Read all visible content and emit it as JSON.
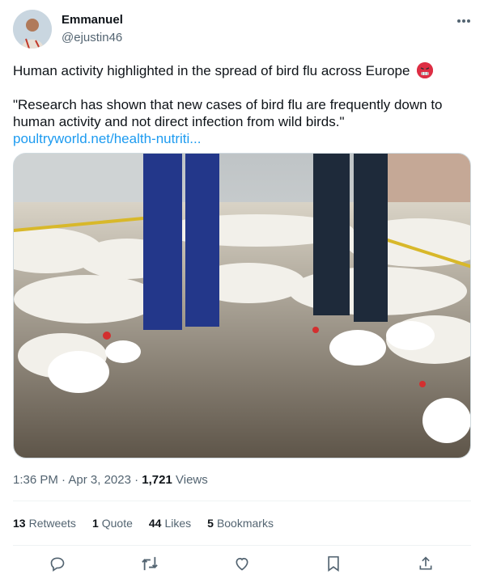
{
  "author": {
    "name": "Emmanuel",
    "handle": "@ejustin46"
  },
  "tweet": {
    "line1": "Human activity highlighted in the spread of bird flu across Europe",
    "quote": "\"Research has shown that new cases of bird flu are frequently down to human activity and not direct infection from wild birds.\"",
    "link": "poultryworld.net/health-nutriti...",
    "emoji": "angry-face-emoji"
  },
  "meta": {
    "time": "1:36 PM",
    "date": "Apr 3, 2023",
    "sep": "·",
    "views_count": "1,721",
    "views_label": "Views"
  },
  "stats": {
    "retweets_count": "13",
    "retweets_label": "Retweets",
    "quotes_count": "1",
    "quotes_label": "Quote",
    "likes_count": "44",
    "likes_label": "Likes",
    "bookmarks_count": "5",
    "bookmarks_label": "Bookmarks"
  },
  "icons": {
    "more": "more-icon",
    "reply": "reply-icon",
    "retweet": "retweet-icon",
    "like": "like-icon",
    "bookmark": "bookmark-icon",
    "share": "share-icon"
  },
  "colors": {
    "text": "#0f1419",
    "secondary": "#536471",
    "link": "#1d9bf0",
    "divider": "#eff3f4"
  }
}
